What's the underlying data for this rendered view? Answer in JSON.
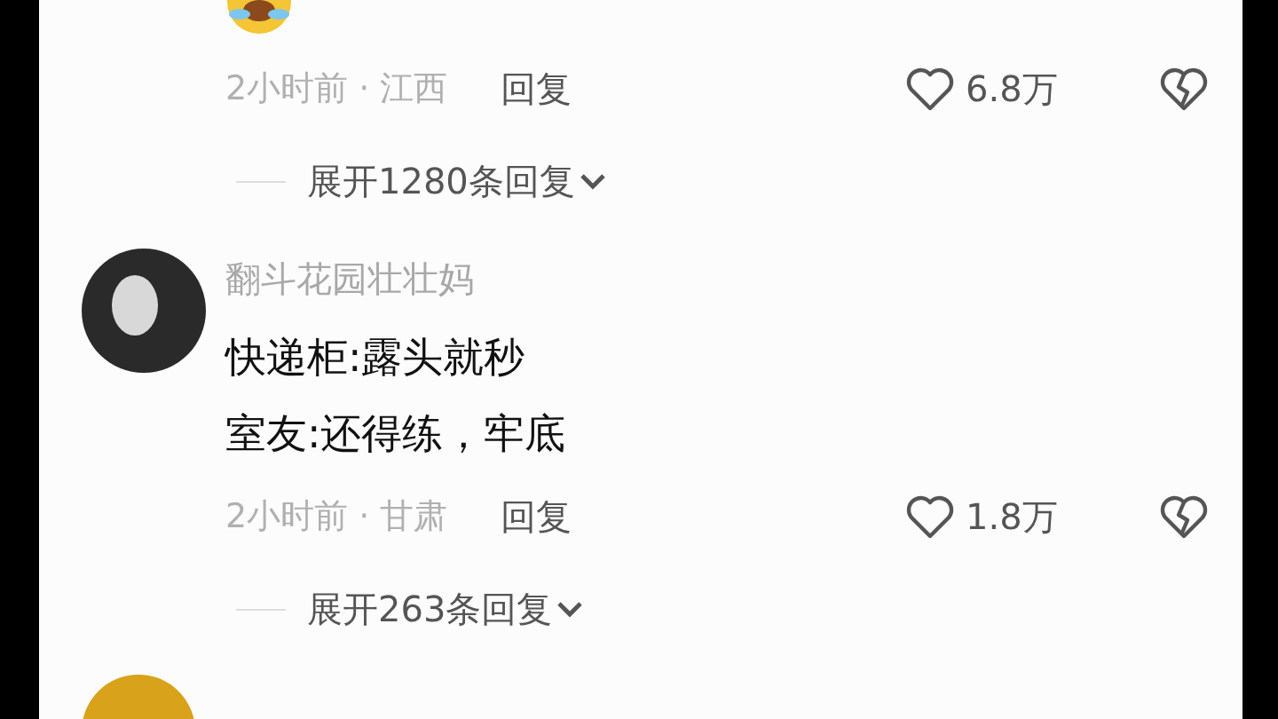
{
  "comments": [
    {
      "kind": "sticker",
      "time": "2小时前",
      "separator": "·",
      "location": "江西",
      "reply": "回复",
      "likes": "6.8万",
      "expand": "展开1280条回复"
    },
    {
      "kind": "text",
      "author": "翻斗花园壮壮妈",
      "lines": [
        "快递柜:露头就秒",
        "室友:还得练，牢底"
      ],
      "time": "2小时前",
      "separator": "·",
      "location": "甘肃",
      "reply": "回复",
      "likes": "1.8万",
      "expand": "展开263条回复"
    }
  ]
}
